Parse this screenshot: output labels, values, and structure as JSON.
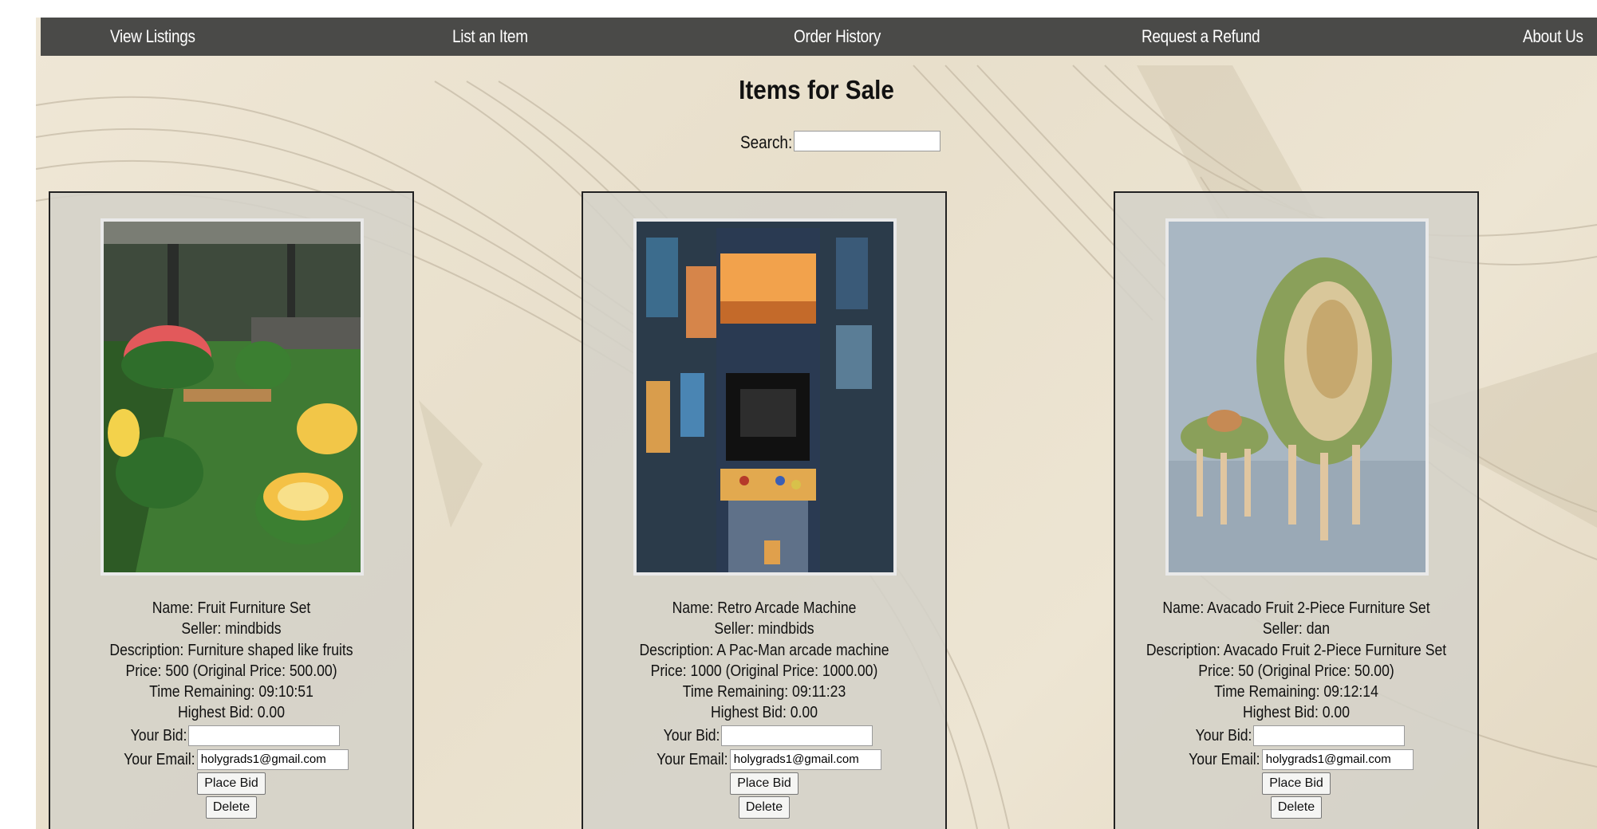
{
  "nav": {
    "items": [
      {
        "label": "View Listings"
      },
      {
        "label": "List an Item"
      },
      {
        "label": "Order History"
      },
      {
        "label": "Request a Refund"
      },
      {
        "label": "About Us"
      }
    ]
  },
  "page": {
    "title": "Items for Sale",
    "search_label": "Search:",
    "search_value": ""
  },
  "listings": [
    {
      "image_icon": "fruit-furniture-photo",
      "name_line": "Name: Fruit Furniture Set",
      "seller_line": "Seller: mindbids",
      "description_line": "Description: Furniture shaped like fruits",
      "price_line": "Price: 500 (Original Price: 500.00)",
      "time_line": "Time Remaining: 09:10:51",
      "bid_line": "Highest Bid: 0.00",
      "your_bid_label": "Your Bid:",
      "your_bid_value": "",
      "email_label": "Your Email:",
      "email_value": "holygrads1@gmail.com",
      "place_bid_label": "Place Bid",
      "delete_label": "Delete"
    },
    {
      "image_icon": "arcade-machine-photo",
      "name_line": "Name: Retro Arcade Machine",
      "seller_line": "Seller: mindbids",
      "description_line": "Description: A Pac-Man arcade machine",
      "price_line": "Price: 1000 (Original Price: 1000.00)",
      "time_line": "Time Remaining: 09:11:23",
      "bid_line": "Highest Bid: 0.00",
      "your_bid_label": "Your Bid:",
      "your_bid_value": "",
      "email_label": "Your Email:",
      "email_value": "holygrads1@gmail.com",
      "place_bid_label": "Place Bid",
      "delete_label": "Delete"
    },
    {
      "image_icon": "avocado-chair-photo",
      "name_line": "Name: Avacado Fruit 2-Piece Furniture Set",
      "seller_line": "Seller: dan",
      "description_line": "Description: Avacado Fruit 2-Piece Furniture Set",
      "price_line": "Price: 50 (Original Price: 50.00)",
      "time_line": "Time Remaining: 09:12:14",
      "bid_line": "Highest Bid: 0.00",
      "your_bid_label": "Your Bid:",
      "your_bid_value": "",
      "email_label": "Your Email:",
      "email_value": "holygrads1@gmail.com",
      "place_bid_label": "Place Bid",
      "delete_label": "Delete"
    }
  ]
}
